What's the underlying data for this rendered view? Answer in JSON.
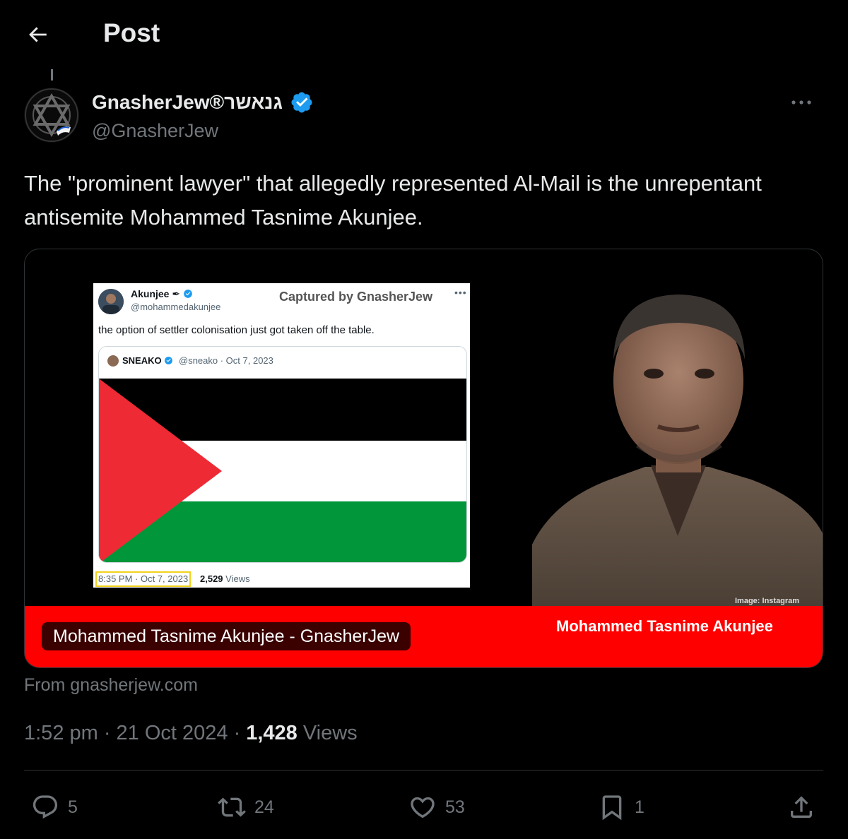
{
  "header": {
    "title": "Post"
  },
  "author": {
    "display_name": "GnasherJew®גנאשר",
    "handle": "@GnasherJew",
    "verified": true
  },
  "post": {
    "text": "The \"prominent lawyer\" that allegedly represented Al-Mail is the unrepentant antisemite Mohammed Tasnime Akunjee.",
    "timestamp": "1:52 pm · 21 Oct 2024",
    "separator": "·",
    "views_count": "1,428",
    "views_label": "Views"
  },
  "card": {
    "label": "Mohammed Tasnime Akunjee - GnasherJew",
    "source": "From gnasherjew.com",
    "image": {
      "embedded_tweet": {
        "name": "Akunjee",
        "handle": "@mohammedakunjee",
        "captured_by": "Captured by GnasherJew",
        "text": "the option of settler colonisation just got taken off the table.",
        "quote_name": "SNEAKO",
        "quote_meta": "@sneako · Oct 7, 2023",
        "time": "8:35 PM · Oct 7, 2023",
        "views_count": "2,529",
        "views_label": "Views"
      },
      "photo_credit": "Image: Instagram",
      "band_name": "Mohammed Tasnime Akunjee"
    }
  },
  "actions": {
    "replies": "5",
    "reposts": "24",
    "likes": "53",
    "bookmarks": "1"
  },
  "colors": {
    "background": "#000000",
    "text": "#e7e9ea",
    "muted": "#71767b",
    "verified": "#1d9bf0",
    "band_red": "#ff0000"
  }
}
